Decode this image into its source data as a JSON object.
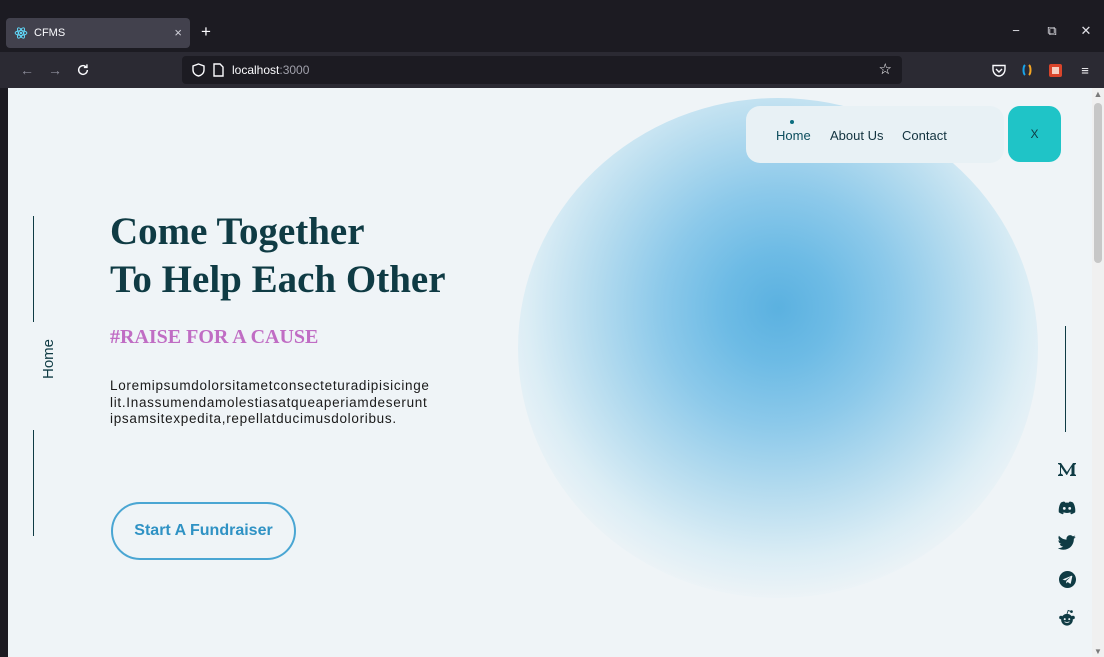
{
  "browser": {
    "tab_title": "CFMS",
    "tab_close": "×",
    "new_tab": "+",
    "url_host": "localhost",
    "url_port": ":3000",
    "window_controls": {
      "minimize": "−",
      "maximize": "⧉",
      "close": "✕"
    },
    "icons": [
      "react-favicon-icon",
      "back-arrow-icon",
      "forward-arrow-icon",
      "reload-icon",
      "shield-icon",
      "page-icon",
      "bookmark-star-icon",
      "pocket-icon",
      "extension-icon",
      "extension-icon-2",
      "menu-icon"
    ]
  },
  "nav": {
    "items": [
      "Home",
      "About Us",
      "Contact"
    ],
    "active": "Home",
    "close_label": "X"
  },
  "side": {
    "label": "Home"
  },
  "hero": {
    "title_line1": "Come Together",
    "title_line2": "To Help Each Other",
    "tagline": "#RAISE FOR A CAUSE",
    "body": "Loremipsumdolorsitametconsecteturadipisicingelit.Inassumendamolestiasatqueaperiamdeseruntipsamsitexpedita,repellatducimusdoloribus.",
    "cta": "Start A Fundraiser"
  },
  "social": [
    "medium-icon",
    "discord-icon",
    "twitter-icon",
    "telegram-icon",
    "reddit-icon"
  ],
  "colors": {
    "brand_dark": "#0f3b44",
    "accent_teal": "#1fc4c7",
    "tagline_purple": "#c06dc4",
    "cta_blue": "#4aa6d3",
    "blob_blue": "#5bb1e0"
  }
}
